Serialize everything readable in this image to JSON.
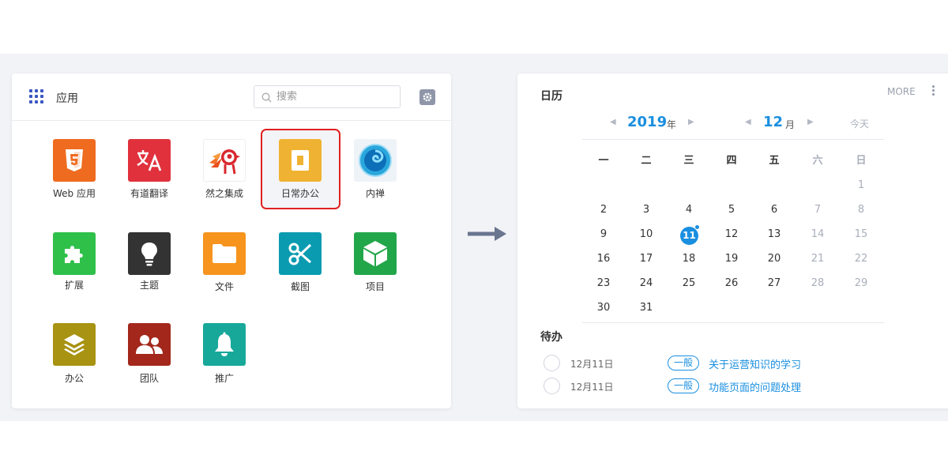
{
  "apps_panel": {
    "title": "应用",
    "search_placeholder": "搜索",
    "apps": [
      {
        "label": "Web 应用",
        "icon": "html5-icon",
        "color": "#ef6b1f"
      },
      {
        "label": "有道翻译",
        "icon": "translate-icon",
        "color": "#e0313d"
      },
      {
        "label": "然之集成",
        "icon": "ranzhi-bird-icon",
        "color": "#ffffff"
      },
      {
        "label": "日常办公",
        "icon": "daily-office-icon",
        "color": "#f0b232"
      },
      {
        "label": "内禅",
        "icon": "neichan-swirl-icon",
        "color": "#2aa7dc"
      },
      {
        "label": "扩展",
        "icon": "puzzle-icon",
        "color": "#2fc04a"
      },
      {
        "label": "主题",
        "icon": "lightbulb-icon",
        "color": "#333333"
      },
      {
        "label": "文件",
        "icon": "folder-icon",
        "color": "#f7941d"
      },
      {
        "label": "截图",
        "icon": "scissors-icon",
        "color": "#0b9bb0"
      },
      {
        "label": "项目",
        "icon": "cube-icon",
        "color": "#22a64a"
      },
      {
        "label": "办公",
        "icon": "layers-icon",
        "color": "#a89312"
      },
      {
        "label": "团队",
        "icon": "team-icon",
        "color": "#a3271b"
      },
      {
        "label": "推广",
        "icon": "bell-icon",
        "color": "#17a89a"
      }
    ]
  },
  "calendar": {
    "title": "日历",
    "more": "MORE",
    "year": "2019",
    "year_unit": "年",
    "month": "12",
    "month_unit": "月",
    "today": "今天",
    "weekdays": [
      "一",
      "二",
      "三",
      "四",
      "五",
      "六",
      "日"
    ],
    "weeks": [
      [
        "",
        "",
        "",
        "",
        "",
        "",
        "1"
      ],
      [
        "2",
        "3",
        "4",
        "5",
        "6",
        "7",
        "8"
      ],
      [
        "9",
        "10",
        "11",
        "12",
        "13",
        "14",
        "15"
      ],
      [
        "16",
        "17",
        "18",
        "19",
        "20",
        "21",
        "22"
      ],
      [
        "23",
        "24",
        "25",
        "26",
        "27",
        "28",
        "29"
      ],
      [
        "30",
        "31",
        "",
        "",
        "",
        "",
        ""
      ]
    ],
    "selected_day": "11"
  },
  "todo": {
    "title": "待办",
    "items": [
      {
        "date": "12月11日",
        "tag": "一般",
        "text": "关于运营知识的学习"
      },
      {
        "date": "12月11日",
        "tag": "一般",
        "text": "功能页面的问题处理"
      }
    ]
  },
  "colors": {
    "accent": "#1a8fe0",
    "highlight": "#e02020",
    "arrow": "#6a7590"
  }
}
